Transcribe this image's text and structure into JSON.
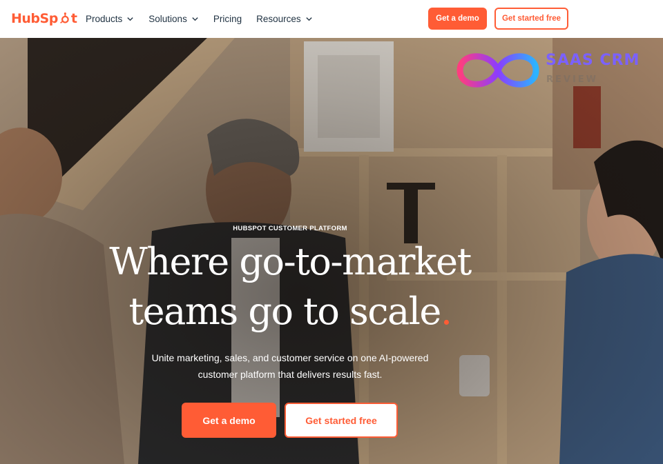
{
  "nav": {
    "logo_text_left": "HubSp",
    "logo_text_right": "t",
    "menu": [
      {
        "label": "Products",
        "has_dropdown": true
      },
      {
        "label": "Solutions",
        "has_dropdown": true
      },
      {
        "label": "Pricing",
        "has_dropdown": false
      },
      {
        "label": "Resources",
        "has_dropdown": true
      }
    ],
    "demo_button": "Get a demo",
    "free_button": "Get started free"
  },
  "hero": {
    "eyebrow": "HUBSPOT CUSTOMER PLATFORM",
    "headline_line1": "Where go-to-market",
    "headline_line2": "teams go to scale",
    "headline_dot": ".",
    "subtext_line1": "Unite marketing, sales, and customer service on one AI-powered",
    "subtext_line2": "customer platform that delivers results fast.",
    "demo_button": "Get a demo",
    "free_button": "Get started free"
  },
  "watermark": {
    "title": "SAAS CRM",
    "subtitle": "REVIEW"
  },
  "colors": {
    "brand_orange": "#ff5c35",
    "nav_text": "#213343",
    "watermark_purple": "#7b61ff"
  }
}
